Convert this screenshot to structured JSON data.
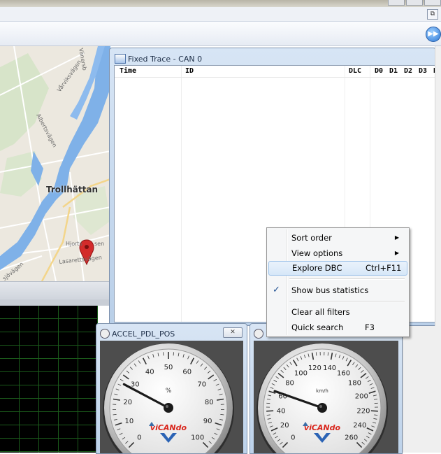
{
  "trace_window": {
    "title": "Fixed Trace - CAN 0",
    "columns": [
      "Time",
      "ID",
      "DLC",
      "D0",
      "D1",
      "D2",
      "D3",
      "D"
    ]
  },
  "map": {
    "city": "Trollhättan",
    "streets": [
      "Vänersb",
      "Vårviksvägen",
      "Albertsvägen",
      "Hjorts",
      "sen",
      "Lasarettsvägen",
      "sjövägen"
    ]
  },
  "context_menu": {
    "items": [
      {
        "label": "Sort order",
        "shortcut": "",
        "submenu": true
      },
      {
        "label": "View options",
        "shortcut": "",
        "submenu": true
      },
      {
        "label": "Explore DBC",
        "shortcut": "Ctrl+F11",
        "submenu": false,
        "highlighted": true
      },
      {
        "label": "Show bus statistics",
        "shortcut": "",
        "submenu": false,
        "checked": true
      },
      {
        "label": "Clear all filters",
        "shortcut": "",
        "submenu": false
      },
      {
        "label": "Quick search",
        "shortcut": "F3",
        "submenu": false
      }
    ]
  },
  "gauge_left": {
    "title": "ACCEL_PDL_POS",
    "unit": "%",
    "ticks": [
      "0",
      "10",
      "20",
      "30",
      "40",
      "50",
      "60",
      "70",
      "80",
      "90",
      "100"
    ],
    "value": 27,
    "min": 0,
    "max": 100,
    "brand": "viCANdo"
  },
  "gauge_right": {
    "title": "",
    "unit": "km/h",
    "ticks": [
      "0",
      "20",
      "40",
      "60",
      "80",
      "100",
      "120",
      "140",
      "160",
      "180",
      "200",
      "220",
      "240",
      "260"
    ],
    "value": 62,
    "min": 0,
    "max": 260,
    "brand": "viCANdo"
  },
  "icons": {
    "restore": "restore-icon",
    "play": "fast-forward-icon",
    "check": "✓",
    "submenu_arrow": "▶",
    "close": "close-icon"
  },
  "colors": {
    "brand_red": "#d9261c",
    "brand_blue": "#2b63b5",
    "map_water": "#7fb1e8",
    "pin": "#d32b2b"
  }
}
